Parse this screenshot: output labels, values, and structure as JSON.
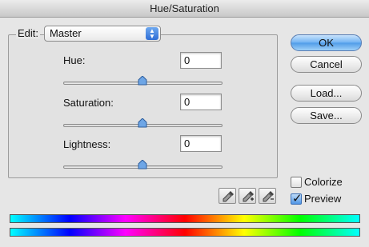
{
  "window": {
    "title": "Hue/Saturation"
  },
  "edit": {
    "label": "Edit:",
    "selected": "Master"
  },
  "sliders": {
    "hue": {
      "label": "Hue:",
      "value": "0"
    },
    "saturation": {
      "label": "Saturation:",
      "value": "0"
    },
    "lightness": {
      "label": "Lightness:",
      "value": "0"
    }
  },
  "buttons": {
    "ok": "OK",
    "cancel": "Cancel",
    "load": "Load...",
    "save": "Save..."
  },
  "options": {
    "colorize": {
      "label": "Colorize",
      "checked": false
    },
    "preview": {
      "label": "Preview",
      "checked": true
    }
  },
  "icons": [
    "eyedropper-icon",
    "eyedropper-plus-icon",
    "eyedropper-minus-icon",
    "chevron-up-down-icon"
  ],
  "colors": {
    "default_button": "#5aa3ec",
    "select_arrows": "#2f6ed6"
  }
}
